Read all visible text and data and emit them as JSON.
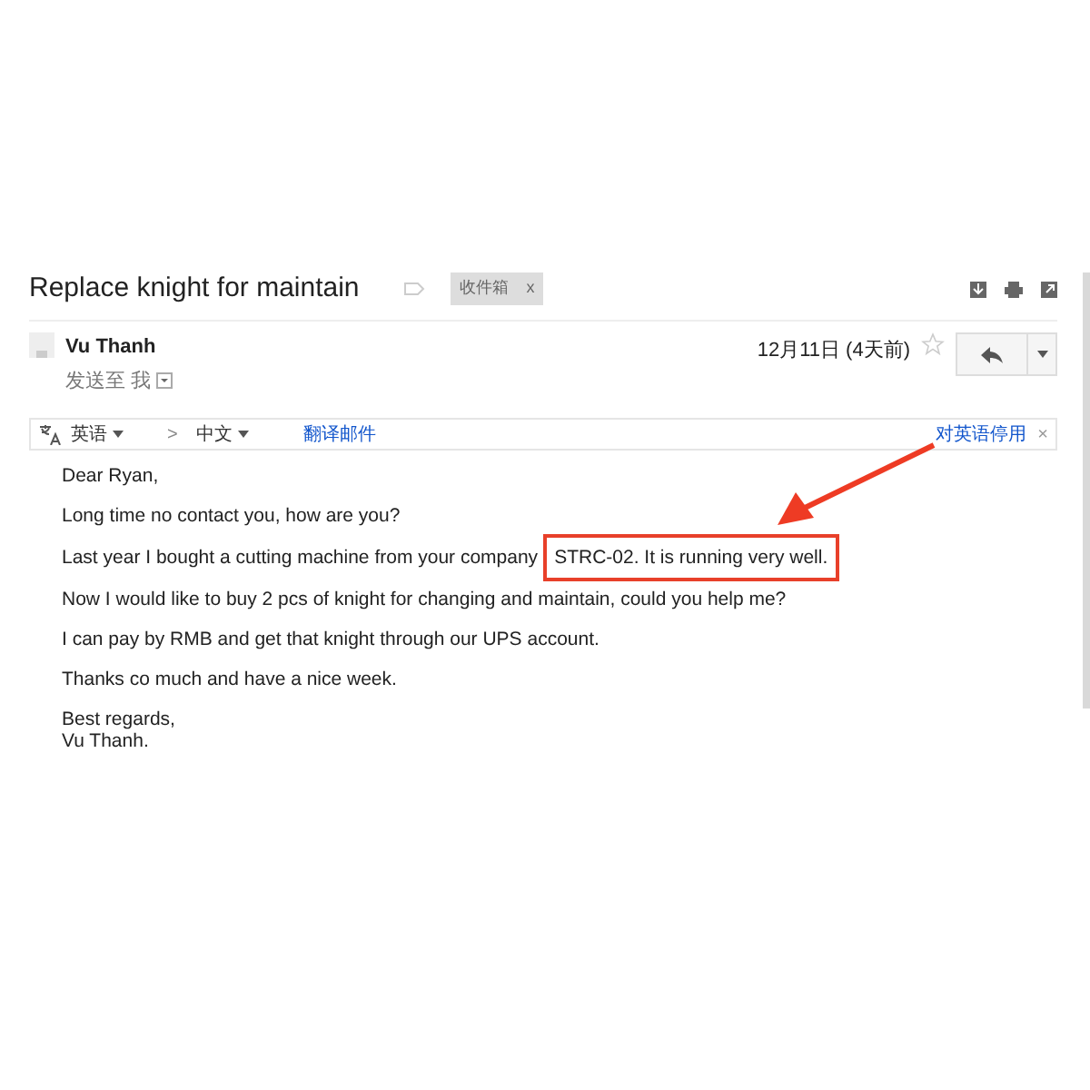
{
  "subject": "Replace knight for maintain",
  "label": {
    "text": "收件箱",
    "close": "x"
  },
  "sender": {
    "name": "Vu Thanh",
    "to_prefix": "发送至",
    "to": "我",
    "date": "12月11日 (4天前)",
    "starred": false
  },
  "translate_bar": {
    "from": "英语",
    "arrow": ">",
    "to": "中文",
    "translate_link": "翻译邮件",
    "disable_link": "对英语停用",
    "close": "×"
  },
  "body": [
    {
      "text": "Dear Ryan,"
    },
    {
      "text": "Long time no contact you, how are you?"
    },
    {
      "text": "Last year I bought a cutting machine from your company",
      "highlight": "STRC-02. It is running very well."
    },
    {
      "text": "Now I would like to buy 2 pcs of knight for changing and maintain, could you help me?"
    },
    {
      "text": "I can pay by RMB and get that knight through our UPS account."
    },
    {
      "text": "Thanks co much and have a nice week."
    },
    {
      "text": "Best regards,\nVu Thanh."
    }
  ]
}
